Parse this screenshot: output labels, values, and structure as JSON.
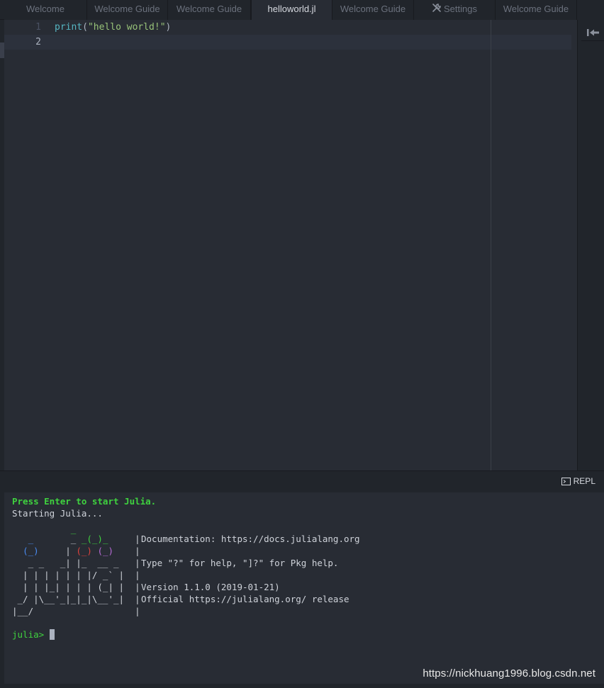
{
  "tabs": [
    {
      "label": "Welcome"
    },
    {
      "label": "Welcome Guide"
    },
    {
      "label": "Welcome Guide"
    },
    {
      "label": "helloworld.jl"
    },
    {
      "label": "Welcome Guide"
    },
    {
      "label": "Settings"
    },
    {
      "label": "Welcome Guide"
    }
  ],
  "active_tab": "helloworld.jl",
  "editor": {
    "lines": [
      {
        "num": "1",
        "fn": "print",
        "open": "(",
        "str": "\"hello world!\"",
        "close": ")"
      },
      {
        "num": "2"
      }
    ]
  },
  "repl": {
    "tab_label": "REPL",
    "press_enter": "Press Enter to start Julia.",
    "starting": "Starting Julia...",
    "doc_line": "Documentation: https://docs.julialang.org",
    "help_line": "Type \"?\" for help, \"]?\" for Pkg help.",
    "version_line": "Version 1.1.0 (2019-01-21)",
    "official_line": "Official https://julialang.org/ release",
    "prompt": "julia>"
  },
  "watermark": "https://nickhuang1996.blog.csdn.net",
  "colors": {
    "background": "#282c34",
    "chrome": "#21252b",
    "prompt_green": "#3fd13f",
    "logo_blue": "#4a8cf2",
    "logo_red": "#e0423c",
    "logo_green": "#3fd13f",
    "logo_purple": "#b86bd8"
  },
  "icons": [
    "wrench-icon",
    "collapse-dock-icon",
    "terminal-icon"
  ]
}
